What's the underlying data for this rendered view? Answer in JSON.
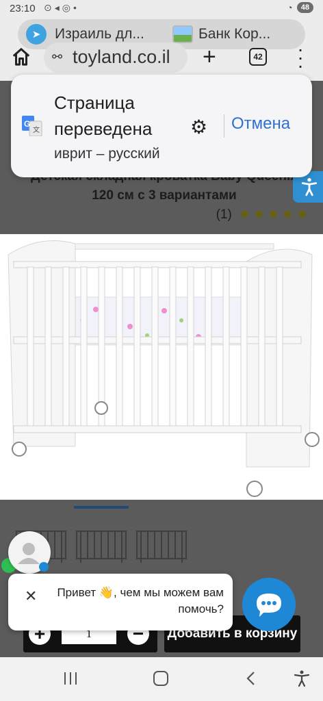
{
  "status_bar": {
    "time": "23:10",
    "battery": "48"
  },
  "browser": {
    "tabs": [
      {
        "title": "Израиль дл..."
      },
      {
        "title": "Банк Кор..."
      }
    ],
    "url": "toyland.co.il",
    "tab_count": "42"
  },
  "translate_popup": {
    "title": "Страница переведена",
    "languages": "иврит – русский",
    "cancel_label": "Отмена"
  },
  "product": {
    "title": "Детская складная кроватка Baby Queenix 120 см с 3 вариантами",
    "rating_count": "(1)",
    "stars": "★★★★★",
    "quantity": "1",
    "add_to_cart_label": "Добавить в корзину"
  },
  "chat": {
    "message": "Привет 👋, чем мы можем вам помочь?"
  },
  "colors": {
    "accent": "#2f6fcf",
    "chat_blue": "#1f88d6",
    "page_overlay": "#5b5b5b"
  }
}
